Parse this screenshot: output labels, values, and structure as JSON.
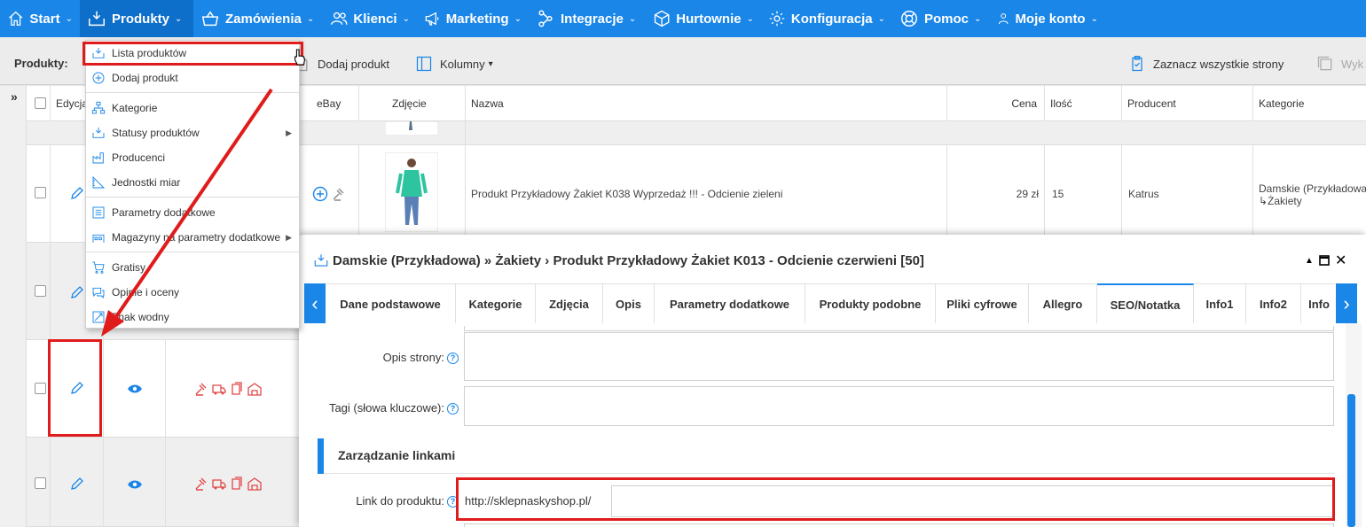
{
  "topnav": {
    "items": [
      {
        "label": "Start",
        "icon": "home-icon"
      },
      {
        "label": "Produkty",
        "icon": "box-download-icon"
      },
      {
        "label": "Zamówienia",
        "icon": "basket-icon"
      },
      {
        "label": "Klienci",
        "icon": "users-icon"
      },
      {
        "label": "Marketing",
        "icon": "megaphone-icon"
      },
      {
        "label": "Integracje",
        "icon": "share-nodes-icon"
      },
      {
        "label": "Hurtownie",
        "icon": "cube-icon"
      },
      {
        "label": "Konfiguracja",
        "icon": "gear-icon"
      },
      {
        "label": "Pomoc",
        "icon": "lifebuoy-icon"
      },
      {
        "label": "Moje konto",
        "icon": "user-icon"
      }
    ]
  },
  "toolbar": {
    "label": "Produkty:",
    "add_product": "Dodaj produkt",
    "columns": "Kolumny",
    "select_all_pages": "Zaznacz wszystkie strony",
    "cut_label": "Wyk"
  },
  "dropdown": {
    "items": [
      {
        "label": "Lista produktów",
        "icon": "box-download-icon"
      },
      {
        "label": "Dodaj produkt",
        "icon": "plus-circle-icon"
      },
      {
        "label": "Kategorie",
        "icon": "sitemap-icon"
      },
      {
        "label": "Statusy produktów",
        "icon": "box-download-icon",
        "submenu": true
      },
      {
        "label": "Producenci",
        "icon": "factory-icon"
      },
      {
        "label": "Jednostki miar",
        "icon": "ruler-icon"
      },
      {
        "label": "Parametry dodatkowe",
        "icon": "list-icon"
      },
      {
        "label": "Magazyny na parametry dodatkowe",
        "icon": "warehouse-icon",
        "submenu": true
      },
      {
        "label": "Gratisy",
        "icon": "cart-icon"
      },
      {
        "label": "Opinie i oceny",
        "icon": "chat-icon"
      },
      {
        "label": "Znak wodny",
        "icon": "watermark-icon"
      }
    ]
  },
  "grid": {
    "headers": {
      "edit": "Edycja",
      "ebay": "eBay",
      "image": "Zdjęcie",
      "name": "Nazwa",
      "price": "Cena",
      "qty": "Ilość",
      "producer": "Producent",
      "category": "Kategorie"
    },
    "row1": {
      "name": "Produkt Przykładowy Żakiet K038 Wyprzedaż !!! - Odcienie zieleni",
      "price": "29 zł",
      "qty": "15",
      "producer": "Katrus",
      "category_line1": "Damskie (Przykładowa)",
      "category_line2": "↳Żakiety"
    }
  },
  "modal": {
    "title": "Damskie (Przykładowa) » Żakiety › Produkt Przykładowy Żakiet K013 - Odcienie czerwieni [50]",
    "tabs": [
      "Dane podstawowe",
      "Kategorie",
      "Zdjęcia",
      "Opis",
      "Parametry dodatkowe",
      "Produkty podobne",
      "Pliki cyfrowe",
      "Allegro",
      "SEO/Notatka",
      "Info1",
      "Info2",
      "Info"
    ],
    "active_tab": "SEO/Notatka",
    "fields": {
      "page_description": "Opis strony:",
      "tags": "Tagi (słowa kluczowe):",
      "section": "Zarządzanie linkami",
      "product_link": "Link do produktu:",
      "link_prefix": "http://sklepnaskyshop.pl/"
    }
  },
  "colors": {
    "primary": "#1a86e8",
    "highlight": "#e01b1b",
    "action_red": "#e04848"
  }
}
